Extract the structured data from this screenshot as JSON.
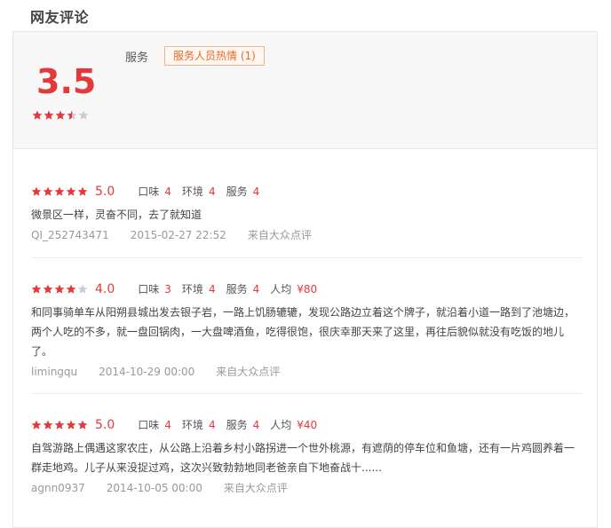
{
  "section_title": "网友评论",
  "summary": {
    "score": "3.5",
    "stars": 3.5,
    "tag_label": "服务",
    "tag": "服务人员热情 (1)"
  },
  "colors": {
    "accent": "#e4393c",
    "star_empty": "#cccccc",
    "tag_text": "#e56b2d",
    "tag_border": "#f4b48a"
  },
  "reviews": [
    {
      "stars": 5,
      "score": "5.0",
      "sub": [
        {
          "label": "口味",
          "value": "4"
        },
        {
          "label": "环境",
          "value": "4"
        },
        {
          "label": "服务",
          "value": "4"
        }
      ],
      "comment": "微景区一样，灵奋不同，去了就知道",
      "user": "QI_252743471",
      "date": "2015-02-27 22:52",
      "source": "来自大众点评"
    },
    {
      "stars": 4,
      "score": "4.0",
      "sub": [
        {
          "label": "口味",
          "value": "3"
        },
        {
          "label": "环境",
          "value": "4"
        },
        {
          "label": "服务",
          "value": "4"
        },
        {
          "label": "人均",
          "value": "¥80"
        }
      ],
      "comment": "和同事骑单车从阳朔县城出发去银子岩，一路上饥肠辘辘，发现公路边立着这个牌子，就沿着小道一路到了池塘边，两个人吃的不多，就一盘回锅肉，一大盘啤酒鱼，吃得很饱，很庆幸那天来了这里，再往后貌似就没有吃饭的地儿了。",
      "user": "limingqu",
      "date": "2014-10-29 00:00",
      "source": "来自大众点评"
    },
    {
      "stars": 5,
      "score": "5.0",
      "sub": [
        {
          "label": "口味",
          "value": "4"
        },
        {
          "label": "环境",
          "value": "4"
        },
        {
          "label": "服务",
          "value": "4"
        },
        {
          "label": "人均",
          "value": "¥40"
        }
      ],
      "comment": "自驾游路上偶遇这家农庄，从公路上沿着乡村小路拐进一个世外桃源，有遮荫的停车位和鱼塘，还有一片鸡圆养着一群走地鸡。儿子从来没捉过鸡，这次兴致勃勃地同老爸亲自下地奋战十......",
      "user": "agnn0937",
      "date": "2014-10-05 00:00",
      "source": "来自大众点评"
    }
  ]
}
